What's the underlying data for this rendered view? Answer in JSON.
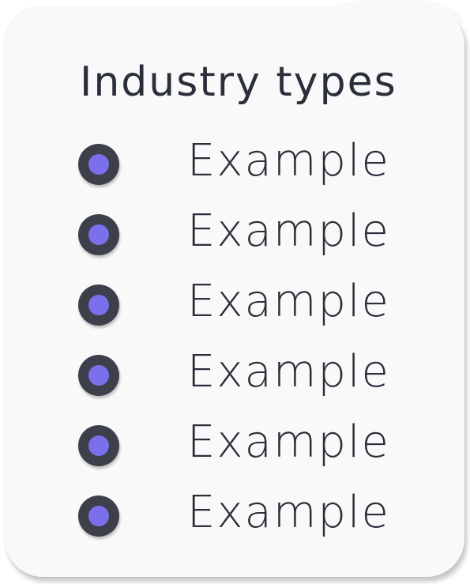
{
  "card": {
    "title": "Industry types",
    "items": [
      {
        "label": "Example"
      },
      {
        "label": "Example"
      },
      {
        "label": "Example"
      },
      {
        "label": "Example"
      },
      {
        "label": "Example"
      },
      {
        "label": "Example"
      }
    ]
  },
  "colors": {
    "card_background": "#f9f9f9",
    "text": "#2b2f3a",
    "bullet_ring": "#3d404b",
    "bullet_fill": "#7b70ec"
  },
  "icons": {
    "bullet": "radio-dot-icon"
  }
}
